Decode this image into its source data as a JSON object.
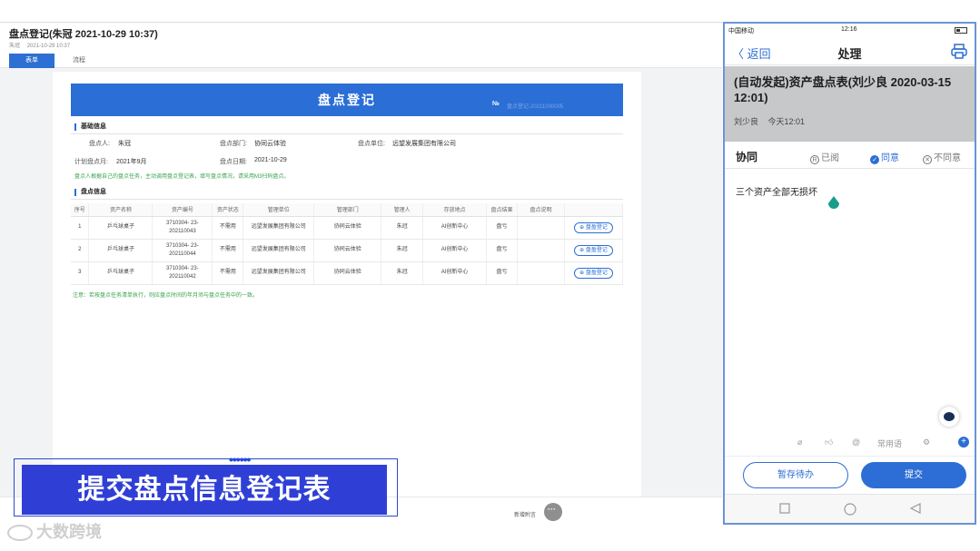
{
  "web": {
    "title": "盘点登记(朱冠 2021-10-29 10:37)",
    "sub_user": "朱冠",
    "sub_time": "2021-10-29 10:37",
    "tabs": [
      "表单",
      "流程"
    ],
    "form_title": "盘点登记",
    "form_no_label": "№",
    "form_no_value": "盘点登记-20211000005",
    "section1": "基础信息",
    "fields": {
      "person_label": "盘点人:",
      "person": "朱冠",
      "dept_label": "盘点部门:",
      "dept": "协同云体验",
      "unit_label": "盘点单位:",
      "unit": "远望发展集团有限公司",
      "plan_label": "计划盘点月:",
      "plan": "2021年9月",
      "date_label": "盘点日期:",
      "date": "2021-10-29"
    },
    "hint": "盘点人根据自己的盘点任务，主动调用盘点登记表，填写盘点情况，请采用M3扫码盘点。",
    "section2": "盘点信息",
    "table": {
      "headers": [
        "序号",
        "资产名称",
        "资产编号",
        "资产状态",
        "管理单位",
        "管理部门",
        "管理人",
        "存放地点",
        "盘点结果",
        "盘点说明",
        ""
      ],
      "rows": [
        {
          "no": "1",
          "name": "乒乓球桌子",
          "code": "3710304- 23-202110043",
          "status": "不需用",
          "unit": "远望发展集团有限公司",
          "dept": "协同云体验",
          "manager": "朱冠",
          "location": "AI创新中心",
          "result": "盘亏",
          "note": "",
          "action": "⊕ 盘盈登记"
        },
        {
          "no": "2",
          "name": "乒乓球桌子",
          "code": "3710304- 23-202110044",
          "status": "不需用",
          "unit": "远望发展集团有限公司",
          "dept": "协同云体验",
          "manager": "朱冠",
          "location": "AI创新中心",
          "result": "盘亏",
          "note": "",
          "action": "⊕ 盘盈登记"
        },
        {
          "no": "3",
          "name": "乒乓球桌子",
          "code": "3710304- 23-202110042",
          "status": "不需用",
          "unit": "远望发展集团有限公司",
          "dept": "协同云体验",
          "manager": "朱冠",
          "location": "AI创新中心",
          "result": "盘亏",
          "note": "",
          "action": "⊕ 盘盈登记"
        }
      ]
    },
    "note": "注意：若按盘点任务清单执行，则应盘点时间的年月须与盘点任务中的一致。",
    "attach_label": "新增附言"
  },
  "caption": {
    "dots": "••••••",
    "text": "提交盘点信息登记表",
    "watermark": "大数跨境"
  },
  "phone": {
    "carrier": "中国移动",
    "clock": "12:16",
    "back": "〈 返回",
    "nav_title": "处理",
    "process_title": "(自动发起)资产盘点表(刘少良 2020-03-15 12:01)",
    "author": "刘少良",
    "time": "今天12:01",
    "opinion_label": "协同",
    "options": [
      {
        "icon": "R",
        "label": "已阅",
        "selected": false
      },
      {
        "icon": "✓",
        "label": "同意",
        "selected": true
      },
      {
        "icon": "✕",
        "label": "不同意",
        "selected": false
      }
    ],
    "opinion_text": "三个资产全部无损坏",
    "common_phrase": "常用语",
    "save_btn": "暂存待办",
    "submit_btn": "提交",
    "accent": "#2c6ed5"
  }
}
